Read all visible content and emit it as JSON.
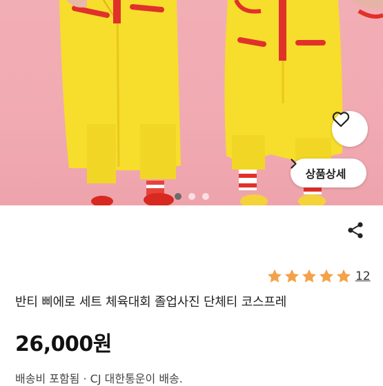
{
  "image": {
    "alt": "반티 삐에로 세트 체육대회 졸업사진 단체티 코스프레",
    "carousel": {
      "count": 3,
      "active": 0
    }
  },
  "buttons": {
    "detail_label": "상품상세",
    "wishlist_icon": "heart-outline-icon",
    "detail_icon": "chevron-right-icon",
    "share_icon": "share-icon"
  },
  "rating": {
    "stars": 5,
    "max_stars": 5,
    "review_count": "12",
    "star_color": "#f4a24a"
  },
  "product": {
    "title": "반티 삐에로 세트 체육대회 졸업사진 단체티 코스프레",
    "price": "26,000원"
  },
  "shipping": {
    "text": "배송비 포함됨 ·   CJ 대한통운이 배송."
  },
  "colors": {
    "background_pink": "#f1aab2",
    "costume_yellow": "#f5dc2a",
    "costume_red": "#e0312a"
  }
}
